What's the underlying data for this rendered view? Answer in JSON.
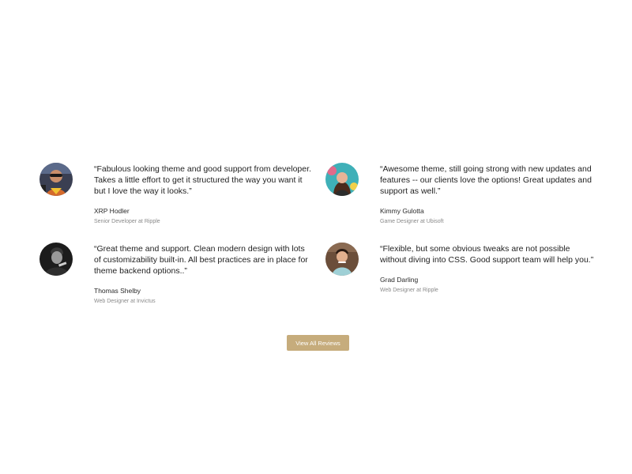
{
  "reviews": [
    {
      "quote": "“Fabulous looking theme and good support from developer. Takes a little effort to get it structured the way you want it but I love the way it looks.”",
      "name": "XRP Hodler",
      "role": "Senior Developer at Ripple",
      "avatar_icon": "person-with-sunglasses-avatar"
    },
    {
      "quote": "“Awesome theme, still going strong with new updates and features -- our clients love the options! Great updates and support as well.”",
      "name": "Kimmy Gulotta",
      "role": "Game Designer at Ubisoft",
      "avatar_icon": "woman-teal-background-avatar"
    },
    {
      "quote": "“Great theme and support. Clean modern design with lots of customizability built-in. All best practices are in place for theme backend options..”",
      "name": "Thomas Shelby",
      "role": "Web Designer at Invictus",
      "avatar_icon": "man-dark-monochrome-avatar"
    },
    {
      "quote": "“Flexible, but some obvious tweaks are not possible without diving into CSS. Good support team will help you.”",
      "name": "Grad Darling",
      "role": "Web Designer at Ripple",
      "avatar_icon": "man-smiling-avatar"
    }
  ],
  "cta": {
    "label": "View All Reviews",
    "color": "#c6ac7c"
  }
}
